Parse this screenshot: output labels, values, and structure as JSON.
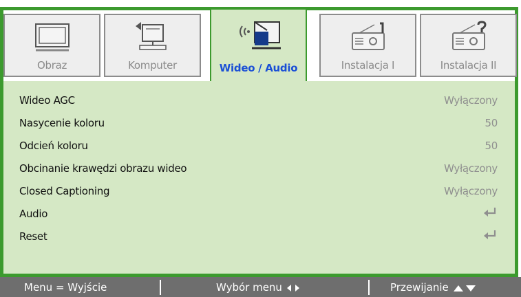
{
  "tabs": [
    {
      "label": "Obraz",
      "icon": "monitor-icon",
      "active": false
    },
    {
      "label": "Komputer",
      "icon": "computer-icon",
      "active": false
    },
    {
      "label": "Wideo / Audio",
      "icon": "video-audio-icon",
      "active": true
    },
    {
      "label": "Instalacja I",
      "icon": "projector-1-icon",
      "active": false
    },
    {
      "label": "Instalacja II",
      "icon": "projector-2-icon",
      "active": false
    }
  ],
  "rows": [
    {
      "label": "Wideo AGC",
      "value": "Wyłączony"
    },
    {
      "label": "Nasycenie koloru",
      "value": "50"
    },
    {
      "label": "Odcień koloru",
      "value": "50"
    },
    {
      "label": "Obcinanie krawędzi obrazu wideo",
      "value": "Wyłączony"
    },
    {
      "label": "Closed Captioning",
      "value": "Wyłączony"
    },
    {
      "label": "Audio",
      "value": "",
      "enter_icon": "enter-arrow-icon"
    },
    {
      "label": "Reset",
      "value": "",
      "enter_icon": "enter-arrow-icon"
    }
  ],
  "footer": {
    "menu": "Menu = Wyjście",
    "select": "Wybór menu",
    "scroll": "Przewijanie"
  },
  "colors": {
    "frame": "#3c9a2e",
    "panel": "#d5e8c5",
    "active_tab_text": "#1a4fd6",
    "footer": "#6e6e6e"
  }
}
